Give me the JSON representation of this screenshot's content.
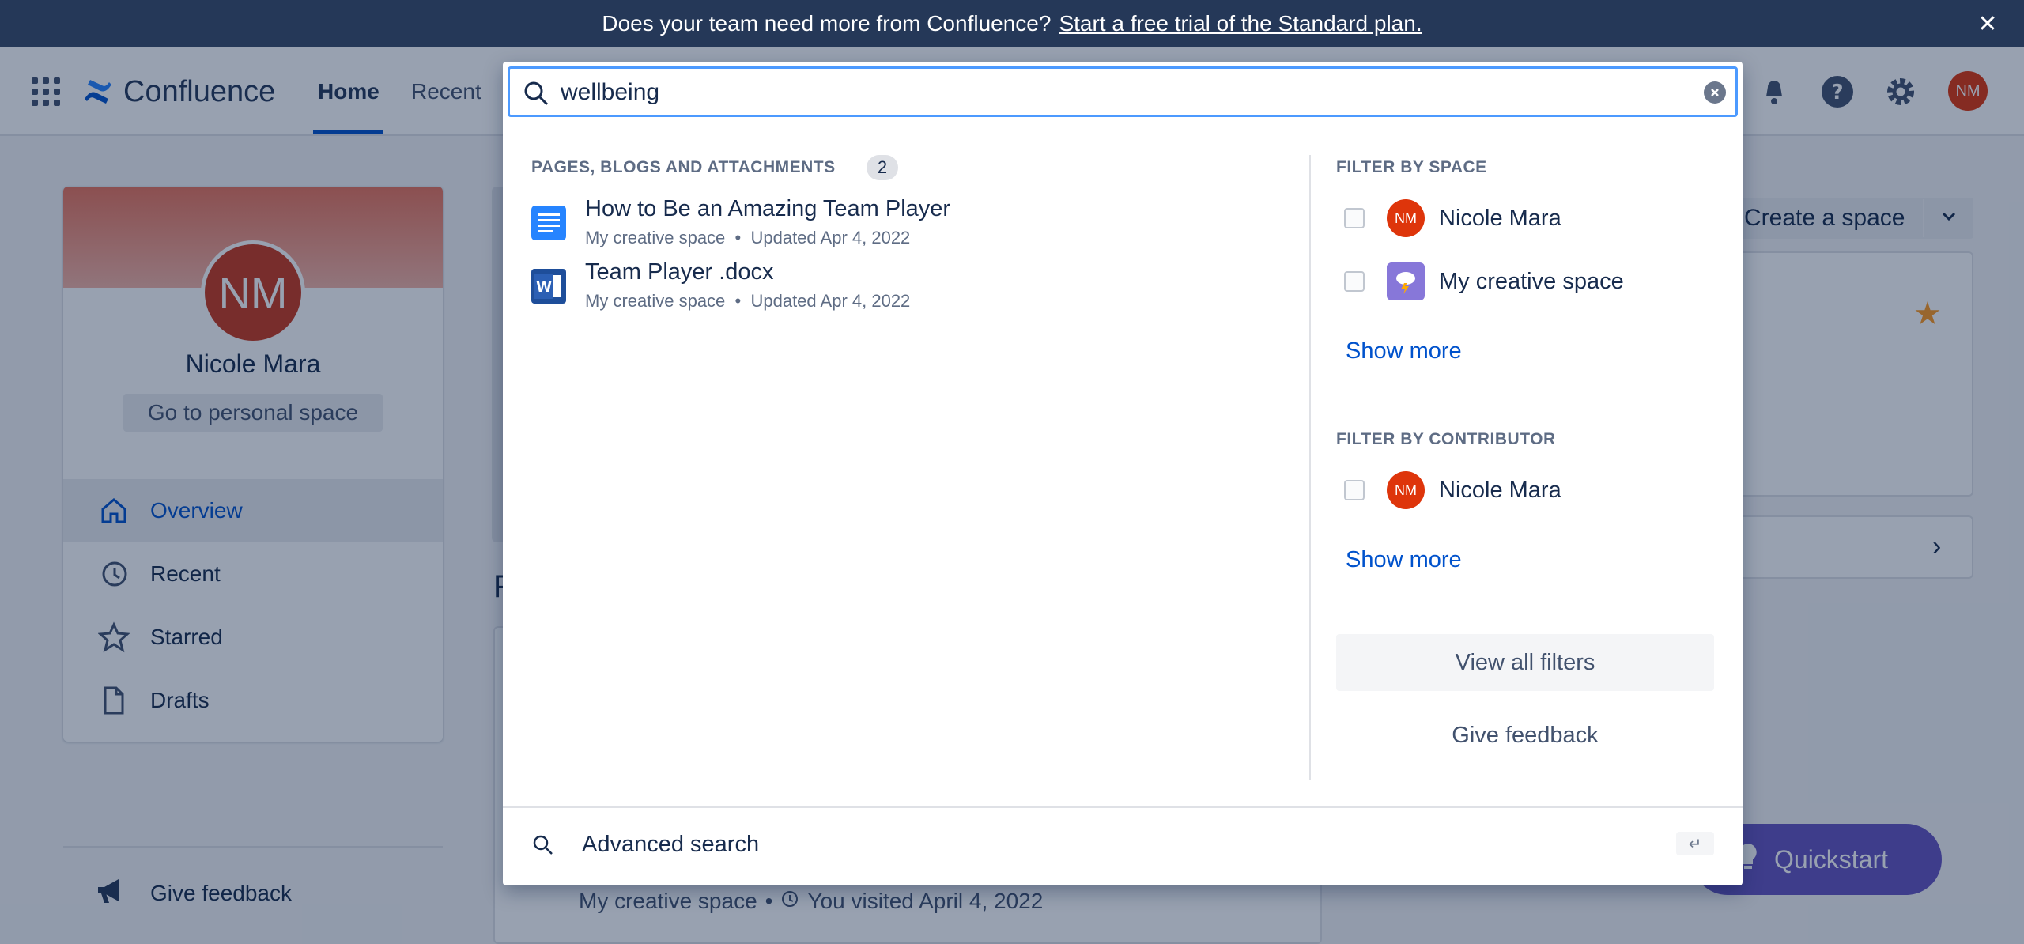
{
  "banner": {
    "text": "Does your team need more from Confluence?",
    "link": "Start a free trial of the Standard plan.",
    "close": "✕"
  },
  "nav": {
    "logo": "Confluence",
    "home": "Home",
    "recent": "Recent",
    "avatar": "NM"
  },
  "profile": {
    "initials": "NM",
    "name": "Nicole Mara",
    "personal_space": "Go to personal space",
    "items": [
      {
        "label": "Overview"
      },
      {
        "label": "Recent"
      },
      {
        "label": "Starred"
      },
      {
        "label": "Drafts"
      }
    ],
    "feedback": "Give feedback"
  },
  "main": {
    "heading_partial": "F",
    "recent_meta_space": "My creative space",
    "recent_meta_visit": "You visited April 4, 2022",
    "create_space": "Create a space",
    "quickstart": "Quickstart"
  },
  "search": {
    "query": "wellbeing",
    "results_label": "PAGES, BLOGS AND ATTACHMENTS",
    "results_count": "2",
    "results": [
      {
        "title": "How to Be an Amazing Team Player",
        "space": "My creative space",
        "updated": "Updated Apr 4, 2022"
      },
      {
        "title": "Team Player .docx",
        "space": "My creative space",
        "updated": "Updated Apr 4, 2022"
      }
    ],
    "filter_space_label": "FILTER BY SPACE",
    "spaces": [
      {
        "name": "Nicole Mara",
        "avatar": "NM"
      },
      {
        "name": "My creative space"
      }
    ],
    "show_more": "Show more",
    "filter_contributor_label": "FILTER BY CONTRIBUTOR",
    "contributors": [
      {
        "name": "Nicole Mara",
        "avatar": "NM"
      }
    ],
    "view_all_filters": "View all filters",
    "give_feedback": "Give feedback",
    "advanced_search": "Advanced search",
    "enter_key": "↵"
  },
  "colors": {
    "banner_bg": "#253858",
    "brand_blue": "#0052cc",
    "focus_ring": "#4c9aff",
    "avatar_red": "#de350b",
    "quickstart_purple": "#6554c0"
  }
}
